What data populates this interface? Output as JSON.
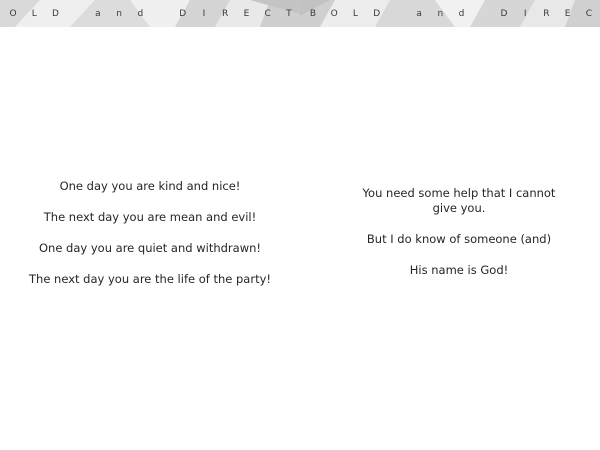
{
  "banner": {
    "left_letters": [
      "O",
      "L",
      "D",
      "",
      "a",
      "n",
      "d",
      "",
      "D",
      "I",
      "R",
      "E",
      "C",
      "T"
    ],
    "right_letters": [
      "B",
      "O",
      "L",
      "D",
      "",
      "a",
      "n",
      "d",
      "",
      "D",
      "I",
      "R",
      "E",
      "C"
    ]
  },
  "left_page": {
    "lines": [
      "One day you are kind and nice!",
      "The next day you are mean and evil!",
      "One day you are quiet and withdrawn!",
      "The next day you are the life of the party!"
    ]
  },
  "right_page": {
    "lines": [
      "You need some help that I cannot give you.",
      "But I do know of someone (and)",
      "His name is God!"
    ]
  },
  "colors": {
    "banner_bg": "#e6e6e6",
    "banner_shade": "#c8c8c8",
    "text": "#262626"
  }
}
